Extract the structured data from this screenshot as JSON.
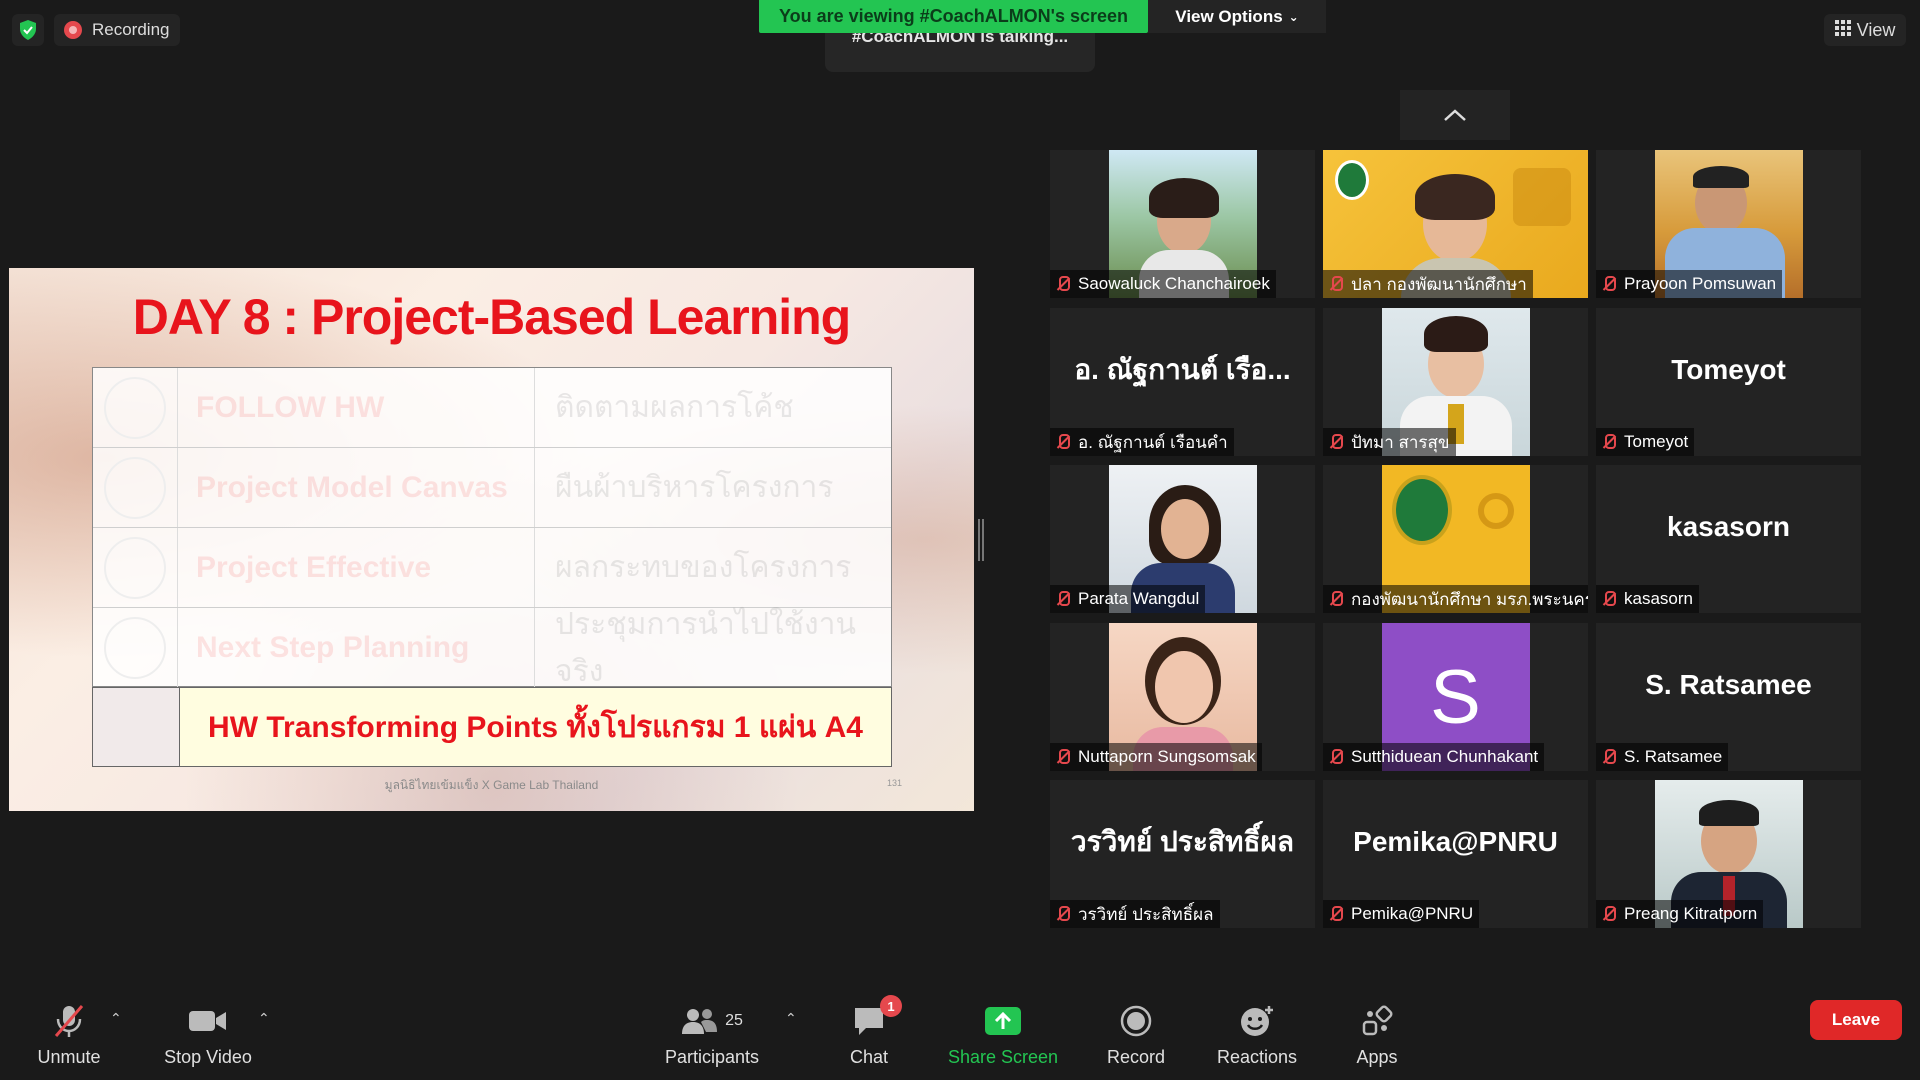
{
  "top_bar": {
    "recording_label": "Recording",
    "viewing_banner": "You are viewing #CoachALMON's screen",
    "view_options_label": "View Options",
    "talking_text": "#CoachALMON is talking...",
    "view_label": "View"
  },
  "slide": {
    "title": "DAY 8 : Project-Based Learning",
    "rows": [
      {
        "left": "FOLLOW HW",
        "right": "ติดตามผลการโค้ช"
      },
      {
        "left": "Project Model Canvas",
        "right": "ผืนผ้าบริหารโครงการ"
      },
      {
        "left": "Project Effective",
        "right": "ผลกระทบของโครงการ"
      },
      {
        "left": "Next Step Planning",
        "right": "ประชุมการนำไปใช้งานจริง"
      }
    ],
    "hw_text": "HW Transforming Points ทั้งโปรแกรม 1 แผ่น A4",
    "footer": "มูลนิธิไทยเข้มแข็ง X Game Lab Thailand",
    "page_number": "131"
  },
  "participants": [
    {
      "name": "Saowaluck Chanchairoek",
      "display": "",
      "has_photo": true
    },
    {
      "name": "ปลา กองพัฒนานักศึกษา",
      "display": "",
      "has_photo": true
    },
    {
      "name": "Prayoon Pomsuwan",
      "display": "",
      "has_photo": true
    },
    {
      "name": "อ. ณัฐกานต์  เรือนคำ",
      "display": "อ. ณัฐกานต์  เรือ...",
      "has_photo": false
    },
    {
      "name": "ปัทมา สารสุข",
      "display": "",
      "has_photo": true
    },
    {
      "name": "Tomeyot",
      "display": "Tomeyot",
      "has_photo": false
    },
    {
      "name": "Parata Wangdul",
      "display": "",
      "has_photo": true
    },
    {
      "name": "กองพัฒนานักศึกษา มรภ.พระนคร",
      "display": "",
      "has_photo": true
    },
    {
      "name": "kasasorn",
      "display": "kasasorn",
      "has_photo": false
    },
    {
      "name": "Nuttaporn Sungsomsak",
      "display": "",
      "has_photo": true
    },
    {
      "name": "Sutthiduean Chunhakant",
      "display": "S",
      "has_photo": false
    },
    {
      "name": "S. Ratsamee",
      "display": "S. Ratsamee",
      "has_photo": false
    },
    {
      "name": "วรวิทย์ ประสิทธิ์ผล",
      "display": "วรวิทย์ ประสิทธิ์ผล",
      "has_photo": false
    },
    {
      "name": "Pemika@PNRU",
      "display": "Pemika@PNRU",
      "has_photo": false
    },
    {
      "name": "Preang Kitratporn",
      "display": "",
      "has_photo": true
    }
  ],
  "toolbar": {
    "unmute": "Unmute",
    "stop_video": "Stop Video",
    "participants": "Participants",
    "participants_count": "25",
    "chat": "Chat",
    "chat_badge": "1",
    "share_screen": "Share Screen",
    "record": "Record",
    "reactions": "Reactions",
    "apps": "Apps",
    "leave": "Leave"
  },
  "colors": {
    "accent_green": "#23c552",
    "leave_red": "#e02828",
    "slide_title_red": "#e8141c",
    "avatar_purple": "#8e4ec6"
  }
}
